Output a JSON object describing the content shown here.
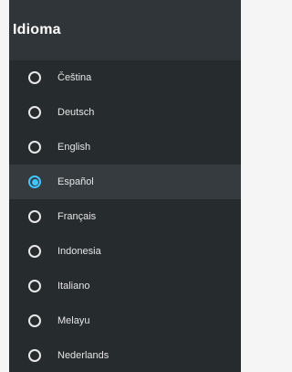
{
  "header": {
    "title": "Idioma"
  },
  "languages": [
    {
      "label": "Čeština",
      "selected": false
    },
    {
      "label": "Deutsch",
      "selected": false
    },
    {
      "label": "English",
      "selected": false
    },
    {
      "label": "Español",
      "selected": true
    },
    {
      "label": "Français",
      "selected": false
    },
    {
      "label": "Indonesia",
      "selected": false
    },
    {
      "label": "Italiano",
      "selected": false
    },
    {
      "label": "Melayu",
      "selected": false
    },
    {
      "label": "Nederlands",
      "selected": false
    }
  ],
  "colors": {
    "panel_bg": "#262b2e",
    "header_bg": "#2f3538",
    "accent": "#40c4ff",
    "selected_row_bg": "#353b3e"
  }
}
